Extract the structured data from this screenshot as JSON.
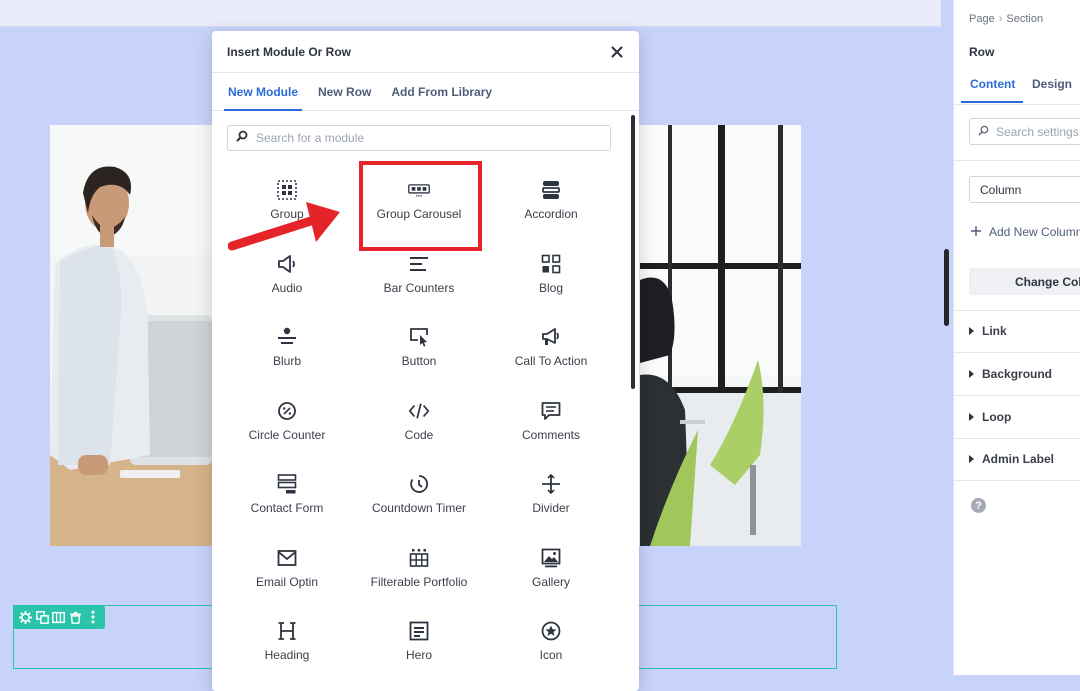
{
  "modal": {
    "title": "Insert Module Or Row",
    "close_icon": "close-icon",
    "tabs": [
      {
        "label": "New Module",
        "active": true
      },
      {
        "label": "New Row",
        "active": false
      },
      {
        "label": "Add From Library",
        "active": false
      }
    ],
    "search_placeholder": "Search for a module",
    "modules": [
      {
        "label": "Group",
        "icon": "group-icon"
      },
      {
        "label": "Group Carousel",
        "icon": "group-carousel-icon"
      },
      {
        "label": "Accordion",
        "icon": "accordion-icon"
      },
      {
        "label": "Audio",
        "icon": "audio-icon"
      },
      {
        "label": "Bar Counters",
        "icon": "bar-counters-icon"
      },
      {
        "label": "Blog",
        "icon": "blog-icon"
      },
      {
        "label": "Blurb",
        "icon": "blurb-icon"
      },
      {
        "label": "Button",
        "icon": "button-icon"
      },
      {
        "label": "Call To Action",
        "icon": "call-to-action-icon"
      },
      {
        "label": "Circle Counter",
        "icon": "circle-counter-icon"
      },
      {
        "label": "Code",
        "icon": "code-icon"
      },
      {
        "label": "Comments",
        "icon": "comments-icon"
      },
      {
        "label": "Contact Form",
        "icon": "contact-form-icon"
      },
      {
        "label": "Countdown Timer",
        "icon": "countdown-timer-icon"
      },
      {
        "label": "Divider",
        "icon": "divider-icon"
      },
      {
        "label": "Email Optin",
        "icon": "email-optin-icon"
      },
      {
        "label": "Filterable Portfolio",
        "icon": "filterable-portfolio-icon"
      },
      {
        "label": "Gallery",
        "icon": "gallery-icon"
      },
      {
        "label": "Heading",
        "icon": "heading-icon"
      },
      {
        "label": "Hero",
        "icon": "hero-icon"
      },
      {
        "label": "Icon",
        "icon": "icon-icon"
      }
    ],
    "highlighted_module": "Group Carousel"
  },
  "panel": {
    "breadcrumb": [
      "Page",
      "Section"
    ],
    "title": "Row",
    "tabs": [
      {
        "label": "Content",
        "active": true
      },
      {
        "label": "Design",
        "active": false
      }
    ],
    "search_placeholder": "Search settings...",
    "column_select_value": "Column",
    "add_column_label": "Add New Column",
    "change_column_label": "Change Column Structure",
    "sections": [
      "Link",
      "Background",
      "Loop",
      "Admin Label"
    ],
    "help_label": "?"
  },
  "row_toolbar": {
    "icons": [
      "gear-icon",
      "duplicate-icon",
      "columns-icon",
      "trash-icon",
      "more-icon"
    ]
  },
  "colors": {
    "accent": "#2b6cd8",
    "canvas_bg": "#c8d3fc",
    "row_outline": "#29c4a9",
    "highlight": "#e5242a"
  }
}
